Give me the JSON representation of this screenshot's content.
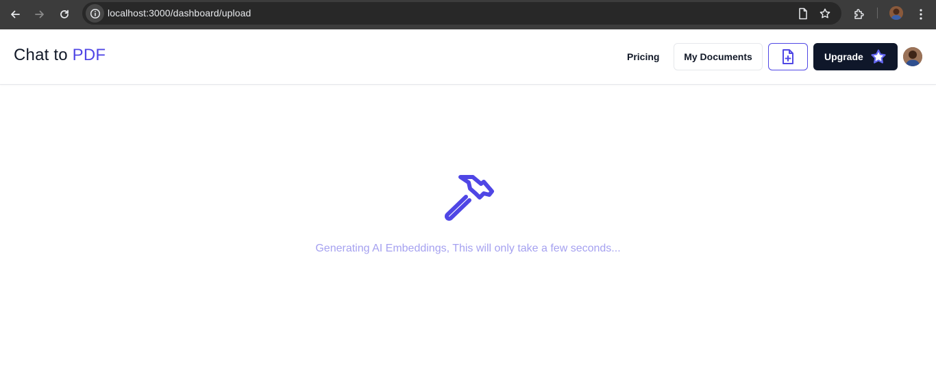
{
  "browser": {
    "url": "localhost:3000/dashboard/upload"
  },
  "header": {
    "brand_prefix": "Chat to",
    "brand_accent": "PDF",
    "pricing_label": "Pricing",
    "my_documents_label": "My Documents",
    "upgrade_label": "Upgrade"
  },
  "main": {
    "status_message": "Generating AI Embeddings, This will only take a few seconds..."
  },
  "colors": {
    "accent": "#4f46e5",
    "upgrade_bg": "#0f172a",
    "status_text": "#a5a1f0"
  },
  "icons": {
    "back": "arrow-left-icon",
    "forward": "arrow-right-icon",
    "reload": "reload-icon",
    "site_info": "info-icon",
    "page": "page-icon",
    "bookmark": "star-icon",
    "extensions": "puzzle-icon",
    "menu": "kebab-menu-icon",
    "new_document": "file-plus-icon",
    "upgrade": "star-icon",
    "loading": "hammer-icon"
  }
}
